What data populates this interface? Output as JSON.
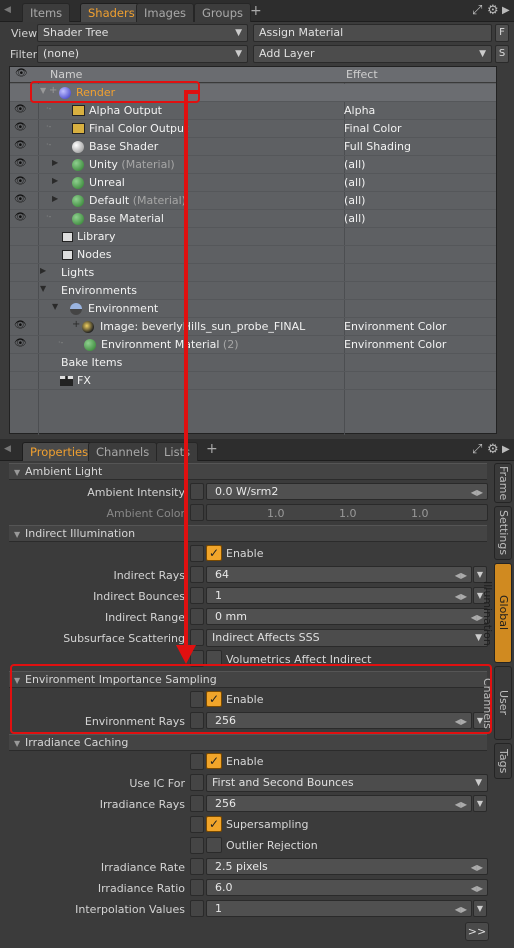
{
  "top_tabs": {
    "items": [
      "Items",
      "Shaders",
      "Images",
      "Groups"
    ],
    "active": "Shaders",
    "add": "+"
  },
  "view": {
    "label": "View",
    "value": "Shader Tree",
    "assign": "Assign Material",
    "f_btn": "F"
  },
  "filter": {
    "label": "Filter",
    "value": "(none)",
    "add_layer": "Add Layer",
    "s_btn": "S"
  },
  "tree": {
    "col_name": "Name",
    "col_effect": "Effect",
    "rows": [
      {
        "name": "Render",
        "effect": "",
        "tag": ""
      },
      {
        "name": "Alpha Output",
        "effect": "Alpha",
        "tag": ""
      },
      {
        "name": "Final Color Output",
        "effect": "Final Color",
        "tag": ""
      },
      {
        "name": "Base Shader",
        "effect": "Full Shading",
        "tag": ""
      },
      {
        "name": "Unity",
        "effect": "(all)",
        "tag": "(Material)"
      },
      {
        "name": "Unreal",
        "effect": "(all)",
        "tag": ""
      },
      {
        "name": "Default",
        "effect": "(all)",
        "tag": "(Material)"
      },
      {
        "name": "Base Material",
        "effect": "(all)",
        "tag": ""
      },
      {
        "name": "Library",
        "effect": "",
        "tag": ""
      },
      {
        "name": "Nodes",
        "effect": "",
        "tag": ""
      },
      {
        "name": "Lights",
        "effect": "",
        "tag": ""
      },
      {
        "name": "Environments",
        "effect": "",
        "tag": ""
      },
      {
        "name": "Environment",
        "effect": "",
        "tag": ""
      },
      {
        "name": "Image: beverlyHills_sun_probe_FINAL",
        "effect": "Environment Color",
        "tag": ""
      },
      {
        "name": "Environment Material",
        "effect": "Environment Color",
        "tag": "(2)"
      },
      {
        "name": "Bake Items",
        "effect": "",
        "tag": ""
      },
      {
        "name": "FX",
        "effect": "",
        "tag": ""
      }
    ]
  },
  "bottom_tabs": {
    "items": [
      "Properties",
      "Channels",
      "Lists"
    ],
    "active": "Properties",
    "add": "+"
  },
  "properties": {
    "ambient": {
      "title": "Ambient Light",
      "intensity_label": "Ambient Intensity",
      "intensity_value": "0.0 W/srm2",
      "color_label": "Ambient Color",
      "color_r": "1.0",
      "color_g": "1.0",
      "color_b": "1.0"
    },
    "indirect": {
      "title": "Indirect Illumination",
      "enable_label": "Enable",
      "rays_label": "Indirect Rays",
      "rays_value": "64",
      "bounces_label": "Indirect Bounces",
      "bounces_value": "1",
      "range_label": "Indirect Range",
      "range_value": "0 mm",
      "sss_label": "Subsurface Scattering",
      "sss_value": "Indirect Affects SSS",
      "volumetrics_label": "Volumetrics Affect Indirect"
    },
    "importance": {
      "title": "Environment Importance Sampling",
      "enable_label": "Enable",
      "rays_label": "Environment Rays",
      "rays_value": "256"
    },
    "irradiance": {
      "title": "Irradiance Caching",
      "enable_label": "Enable",
      "use_label": "Use IC For",
      "use_value": "First and Second Bounces",
      "rays_label": "Irradiance Rays",
      "rays_value": "256",
      "supersampling_label": "Supersampling",
      "outlier_label": "Outlier Rejection",
      "rate_label": "Irradiance Rate",
      "rate_value": "2.5 pixels",
      "ratio_label": "Irradiance Ratio",
      "ratio_value": "6.0",
      "interp_label": "Interpolation Values",
      "interp_value": "1"
    },
    "more_button": ">>"
  },
  "side_tabs": [
    "Frame",
    "Settings",
    "Global Illumination",
    "User Channels",
    "Tags"
  ],
  "active_side_tab": "Global Illumination",
  "accent_color": "#f0a030",
  "highlight_color": "#e01010"
}
